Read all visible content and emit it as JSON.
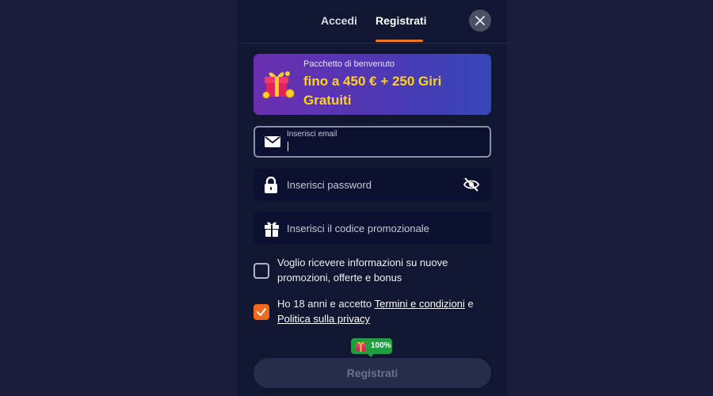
{
  "tabs": [
    {
      "label": "Accedi",
      "active": false
    },
    {
      "label": "Registrati",
      "active": true
    }
  ],
  "banner": {
    "title": "Pacchetto di benvenuto",
    "offer": "fino a 450 € + 250 Giri Gratuiti"
  },
  "email": {
    "label": "Inserisci email",
    "value": ""
  },
  "password": {
    "placeholder": "Inserisci password"
  },
  "promo": {
    "placeholder": "Inserisci il codice promozionale"
  },
  "consents": {
    "newsletter": {
      "text": "Voglio ricevere informazioni su nuove promozioni, offerte e bonus",
      "checked": false
    },
    "terms": {
      "prefix": "Ho 18 anni e accetto ",
      "terms_link": "Termini e condizioni",
      "middle": " e ",
      "privacy_link": "Politica sulla privacy",
      "checked": true
    }
  },
  "badge": {
    "text": "100%"
  },
  "submit_label": "Registrati",
  "colors": {
    "accent": "#ee6a1e",
    "offer_text": "#ffd21a",
    "badge_green": "#1f9e3e",
    "modal_bg": "#111631"
  },
  "icons": [
    "close-icon",
    "gift-icon",
    "envelope-icon",
    "lock-icon",
    "eye-off-icon",
    "checkmark-icon"
  ]
}
